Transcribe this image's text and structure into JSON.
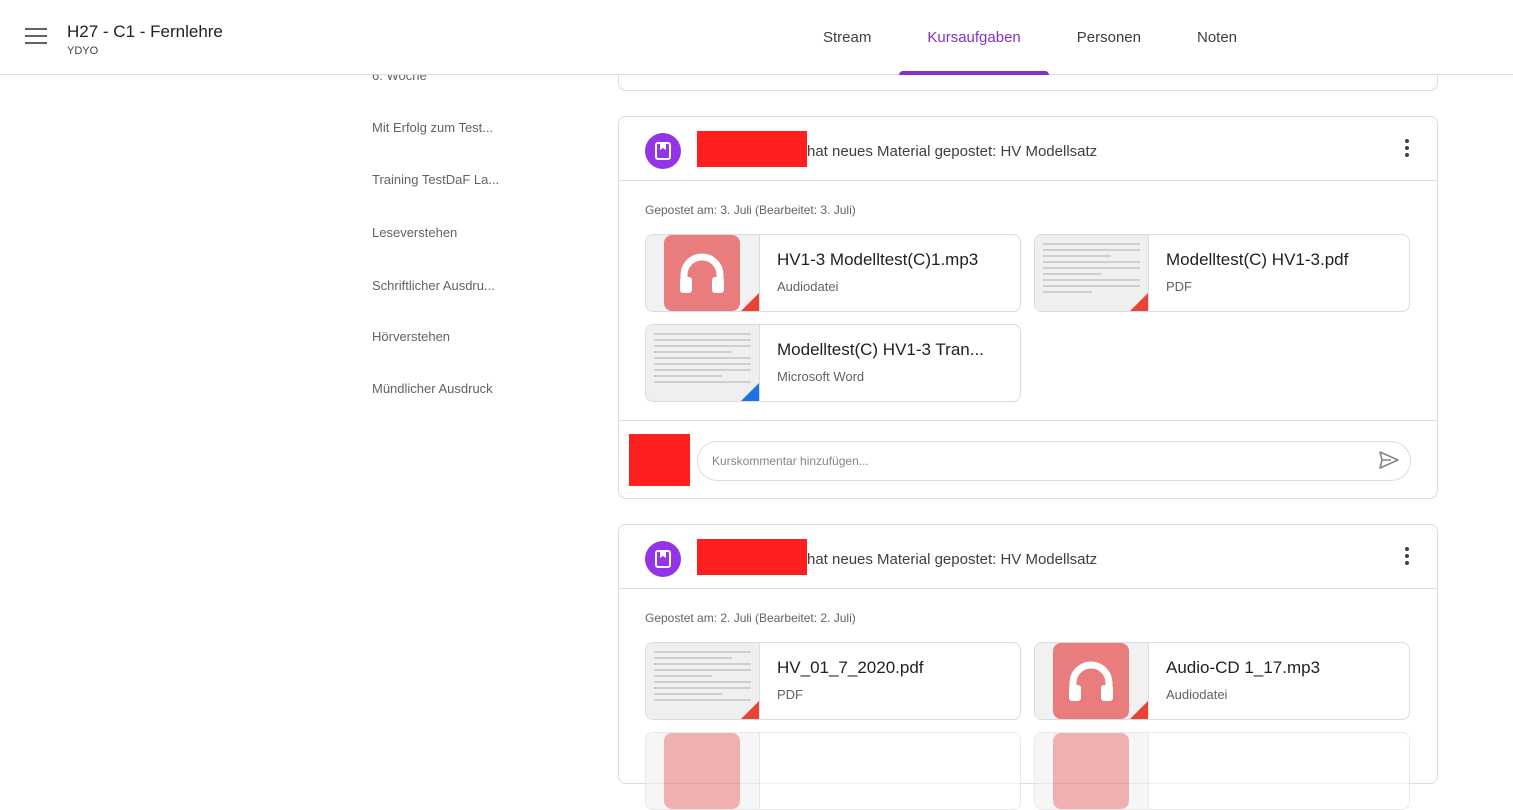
{
  "header": {
    "class_title": "H27 - C1 - Fernlehre",
    "class_section": "YDYO",
    "tabs": [
      {
        "label": "Stream"
      },
      {
        "label": "Kursaufgaben"
      },
      {
        "label": "Personen"
      },
      {
        "label": "Noten"
      }
    ],
    "active_tab": "Kursaufgaben",
    "accent_color": "#8430ce"
  },
  "sidebar": {
    "items": [
      {
        "label": "6. Woche"
      },
      {
        "label": "Mit Erfolg zum Test..."
      },
      {
        "label": "Training TestDaF La..."
      },
      {
        "label": "Leseverstehen"
      },
      {
        "label": "Schriftlicher Ausdru..."
      },
      {
        "label": "Hörverstehen"
      },
      {
        "label": "Mündlicher Ausdruck"
      }
    ]
  },
  "posts": [
    {
      "title": "hat neues Material gepostet: HV Modellsatz",
      "posted": "Gepostet am: 3. Juli (Bearbeitet: 3. Juli)",
      "attachments": [
        {
          "title": "HV1-3 Modelltest(C)1.mp3",
          "type": "Audiodatei",
          "icon": "headphones-icon"
        },
        {
          "title": "Modelltest(C) HV1-3.pdf",
          "type": "PDF",
          "icon": "pdf-thumbnail"
        },
        {
          "title": "Modelltest(C) HV1-3 Tran...",
          "type": "Microsoft Word",
          "icon": "word-thumbnail"
        }
      ],
      "comment_placeholder": "Kurskommentar hinzufügen..."
    },
    {
      "title": "hat neues Material gepostet: HV Modellsatz",
      "posted": "Gepostet am: 2. Juli (Bearbeitet: 2. Juli)",
      "attachments": [
        {
          "title": "HV_01_7_2020.pdf",
          "type": "PDF",
          "icon": "pdf-thumbnail"
        },
        {
          "title": "Audio-CD 1_17.mp3",
          "type": "Audiodatei",
          "icon": "headphones-icon"
        }
      ]
    }
  ],
  "colors": {
    "material_icon": "#9334e6",
    "audio_thumb": "#e97c7c",
    "pdf_corner": "#ea4335",
    "word_corner": "#1a73e8",
    "redaction": "#ff1f1f"
  }
}
